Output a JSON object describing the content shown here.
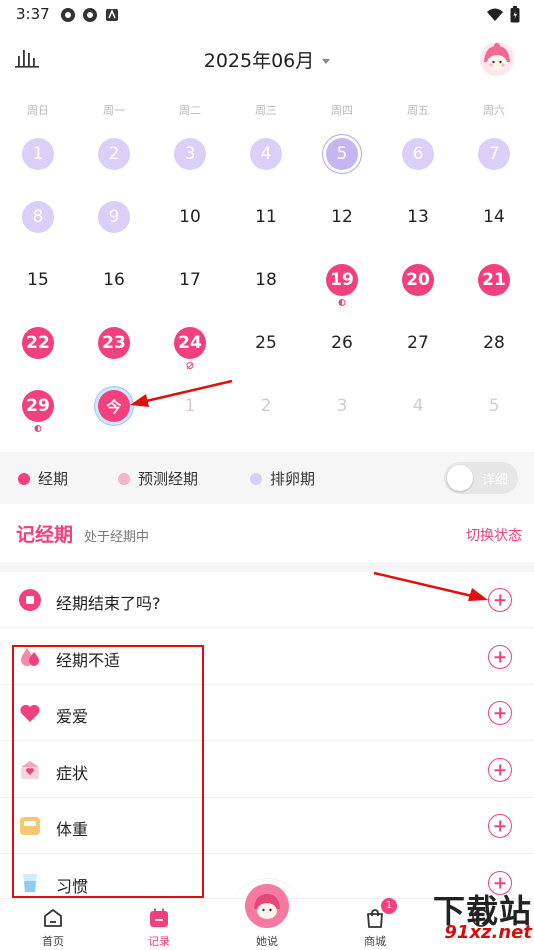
{
  "status_bar": {
    "time": "3:37"
  },
  "header": {
    "month": "2025年06月"
  },
  "weekdays": [
    "周日",
    "周一",
    "周二",
    "周三",
    "周四",
    "周五",
    "周六"
  ],
  "calendar_days": [
    [
      "1",
      "2",
      "3",
      "4",
      "5",
      "6",
      "7"
    ],
    [
      "8",
      "9",
      "10",
      "11",
      "12",
      "13",
      "14"
    ],
    [
      "15",
      "16",
      "17",
      "18",
      "19",
      "20",
      "21"
    ],
    [
      "22",
      "23",
      "24",
      "25",
      "26",
      "27",
      "28"
    ],
    [
      "29",
      "今",
      "1",
      "2",
      "3",
      "4",
      "5"
    ]
  ],
  "legend": {
    "period": "经期",
    "predicted": "预测经期",
    "ovulation": "排卵期",
    "detail_toggle": "详细",
    "colors": {
      "period": "#f0407d",
      "predicted": "#f7b3c9",
      "ovulation": "#d9cff7"
    }
  },
  "record": {
    "title": "记经期",
    "subtitle": "处于经期中",
    "switch_label": "切换状态"
  },
  "rows": [
    {
      "label": "经期结束了吗?",
      "icon": "stop-icon"
    },
    {
      "label": "经期不适",
      "icon": "drops-icon"
    },
    {
      "label": "爱爱",
      "icon": "heart-icon"
    },
    {
      "label": "症状",
      "icon": "envelope-icon"
    },
    {
      "label": "体重",
      "icon": "scale-icon"
    },
    {
      "label": "习惯",
      "icon": "cup-icon"
    }
  ],
  "nav": {
    "home": "首页",
    "record": "记录",
    "talk": "她说",
    "mall": "商城",
    "mall_badge": "1",
    "mine": ""
  },
  "watermark": {
    "line1": "下载站",
    "line2": "91xz.net"
  }
}
